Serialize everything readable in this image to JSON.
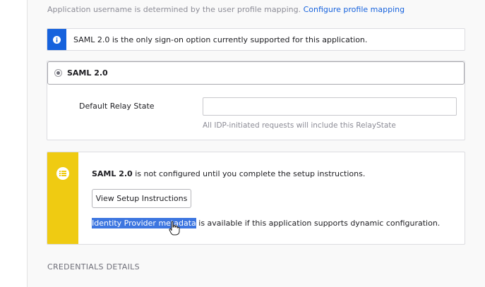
{
  "top_note": {
    "text": "Application username is determined by the user profile mapping.",
    "link": "Configure profile mapping"
  },
  "info_banner": {
    "icon": "info-icon",
    "text": "SAML 2.0 is the only sign-on option currently supported for this application."
  },
  "sign_on": {
    "option_label": "SAML 2.0",
    "selected": true,
    "relay_state": {
      "label": "Default Relay State",
      "value": "",
      "help": "All IDP-initiated requests will include this RelayState"
    }
  },
  "setup_notice": {
    "icon": "list-icon",
    "bold": "SAML 2.0",
    "text": " is not configured until you complete the setup instructions.",
    "button_label": "View Setup Instructions",
    "metadata_link": "Identity Provider metadata",
    "metadata_text": " is available if this application supports dynamic configuration."
  },
  "credentials_heading": "CREDENTIALS DETAILS",
  "colors": {
    "info_accent": "#1662dd",
    "warning_accent": "#efcb12",
    "link": "#1662dd",
    "selection": "#3d76e0"
  }
}
